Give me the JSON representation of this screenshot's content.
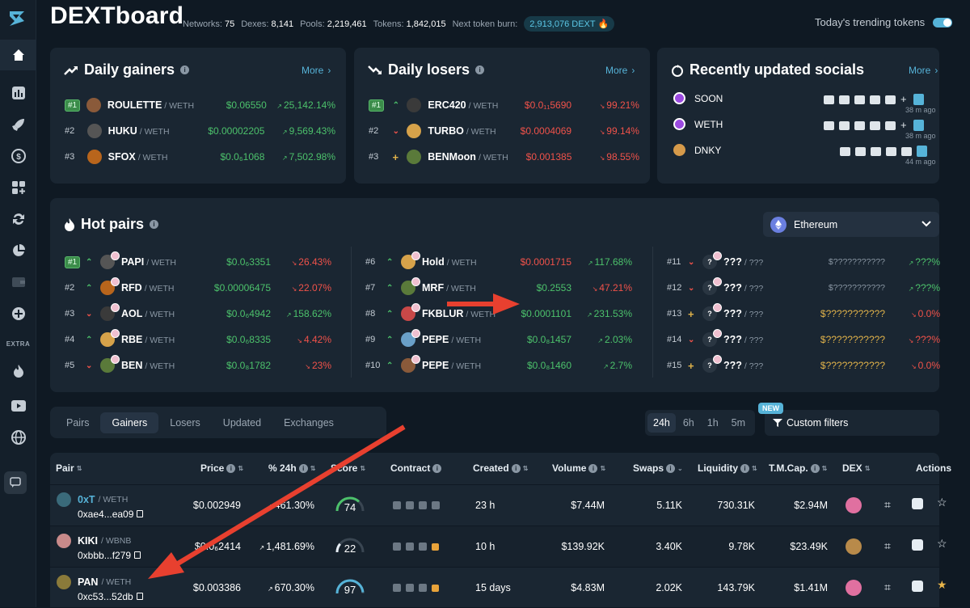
{
  "app": {
    "title": "DEXTboard"
  },
  "stats": [
    {
      "label": "Networks:",
      "value": "75"
    },
    {
      "label": "Dexes:",
      "value": "8,141"
    },
    {
      "label": "Pools:",
      "value": "2,219,461"
    },
    {
      "label": "Tokens:",
      "value": "1,842,015"
    }
  ],
  "burn": {
    "label": "Next token burn:",
    "value": "2,913,076 DEXT"
  },
  "trending": {
    "label": "Today's trending tokens",
    "enabled": true
  },
  "sidebar": {
    "extra_label": "EXTRA"
  },
  "gainers": {
    "title": "Daily gainers",
    "more": "More",
    "rows": [
      {
        "rank": "#1",
        "sym": "ROULETTE",
        "quote": "/ WETH",
        "price": "$0.06550",
        "chg": "25,142.14%"
      },
      {
        "rank": "#2",
        "sym": "HUKU",
        "quote": "/ WETH",
        "price": "$0.00002205",
        "chg": "9,569.43%"
      },
      {
        "rank": "#3",
        "sym": "SFOX",
        "quote": "/ WETH",
        "price": "$0.0₆1068",
        "chg": "7,502.98%"
      }
    ]
  },
  "losers": {
    "title": "Daily losers",
    "more": "More",
    "rows": [
      {
        "rank": "#1",
        "sym": "ERC420",
        "quote": "/ WETH",
        "price": "$0.0₁₁5690",
        "chg": "99.21%"
      },
      {
        "rank": "#2",
        "sym": "TURBO",
        "quote": "/ WETH",
        "price": "$0.0004069",
        "chg": "99.14%"
      },
      {
        "rank": "#3",
        "sym": "BENMoon",
        "quote": "/ WETH",
        "price": "$0.001385",
        "chg": "98.55%"
      }
    ]
  },
  "socials": {
    "title": "Recently updated socials",
    "more": "More",
    "rows": [
      {
        "name": "SOON",
        "ago": "38 m ago"
      },
      {
        "name": "WETH",
        "ago": "38 m ago"
      },
      {
        "name": "DNKY",
        "ago": "44 m ago"
      }
    ]
  },
  "hot": {
    "title": "Hot pairs",
    "network": "Ethereum",
    "col1": [
      {
        "rank": "#1",
        "sym": "PAPI",
        "quote": "/ WETH",
        "price": "$0.0₆3351",
        "chg": "26.43%"
      },
      {
        "rank": "#2",
        "sym": "RFD",
        "quote": "/ WETH",
        "price": "$0.00006475",
        "chg": "22.07%"
      },
      {
        "rank": "#3",
        "sym": "AOL",
        "quote": "/ WETH",
        "price": "$0.0₆4942",
        "chg": "158.62%"
      },
      {
        "rank": "#4",
        "sym": "RBE",
        "quote": "/ WETH",
        "price": "$0.0₆8335",
        "chg": "4.42%"
      },
      {
        "rank": "#5",
        "sym": "BEN",
        "quote": "/ WETH",
        "price": "$0.0₈1782",
        "chg": "23%"
      }
    ],
    "col2": [
      {
        "rank": "#6",
        "sym": "Hold",
        "quote": "/ WETH",
        "price": "$0.0001715",
        "chg": "117.68%"
      },
      {
        "rank": "#7",
        "sym": "MRF",
        "quote": "/ WETH",
        "price": "$0.2553",
        "chg": "47.21%"
      },
      {
        "rank": "#8",
        "sym": "FKBLUR",
        "quote": "/ WETH",
        "price": "$0.0001101",
        "chg": "231.53%"
      },
      {
        "rank": "#9",
        "sym": "PEPE",
        "quote": "/ WETH",
        "price": "$0.0₈1457",
        "chg": "2.03%"
      },
      {
        "rank": "#10",
        "sym": "PEPE",
        "quote": "/ WETH",
        "price": "$0.0₈1460",
        "chg": "2.7%"
      }
    ],
    "col3": [
      {
        "rank": "#11",
        "sym": "???",
        "quote": "/ ???",
        "price": "$???????????",
        "chg": "???%"
      },
      {
        "rank": "#12",
        "sym": "???",
        "quote": "/ ???",
        "price": "$???????????",
        "chg": "???%"
      },
      {
        "rank": "#13",
        "sym": "???",
        "quote": "/ ???",
        "price": "$???????????",
        "chg": "0.0%"
      },
      {
        "rank": "#14",
        "sym": "???",
        "quote": "/ ???",
        "price": "$???????????",
        "chg": "???%"
      },
      {
        "rank": "#15",
        "sym": "???",
        "quote": "/ ???",
        "price": "$???????????",
        "chg": "0.0%"
      }
    ]
  },
  "tabs": [
    "Pairs",
    "Gainers",
    "Losers",
    "Updated",
    "Exchanges"
  ],
  "timeframes": [
    "24h",
    "6h",
    "1h",
    "5m"
  ],
  "filters": {
    "new_badge": "NEW",
    "label": "Custom filters"
  },
  "table": {
    "headers": [
      "Pair",
      "Price",
      "% 24h",
      "Score",
      "Contract",
      "Created",
      "Volume",
      "Swaps",
      "Liquidity",
      "T.M.Cap.",
      "DEX",
      "Actions"
    ],
    "rows": [
      {
        "sym": "0xT",
        "quote": "/ WETH",
        "addr": "0xae4...ea09",
        "price": "$0.002949",
        "chg": "461.30%",
        "score": "74",
        "created": "23 h",
        "volume": "$7.44M",
        "swaps": "5.11K",
        "liq": "730.31K",
        "mcap": "$2.94M"
      },
      {
        "sym": "KIKI",
        "quote": "/ WBNB",
        "addr": "0xbbb...f279",
        "price": "$0.0₆2414",
        "chg": "1,481.69%",
        "score": "22",
        "created": "10 h",
        "volume": "$139.92K",
        "swaps": "3.40K",
        "liq": "9.78K",
        "mcap": "$23.49K"
      },
      {
        "sym": "PAN",
        "quote": "/ WETH",
        "addr": "0xc53...52db",
        "price": "$0.003386",
        "chg": "670.30%",
        "score": "97",
        "created": "15 days",
        "volume": "$4.83M",
        "swaps": "2.02K",
        "liq": "143.79K",
        "mcap": "$1.41M"
      }
    ]
  },
  "colors": {
    "accent": "#56b3d8",
    "green": "#4cc16b",
    "red": "#f0524a",
    "bg": "#0f1923",
    "card": "#1a2632"
  }
}
